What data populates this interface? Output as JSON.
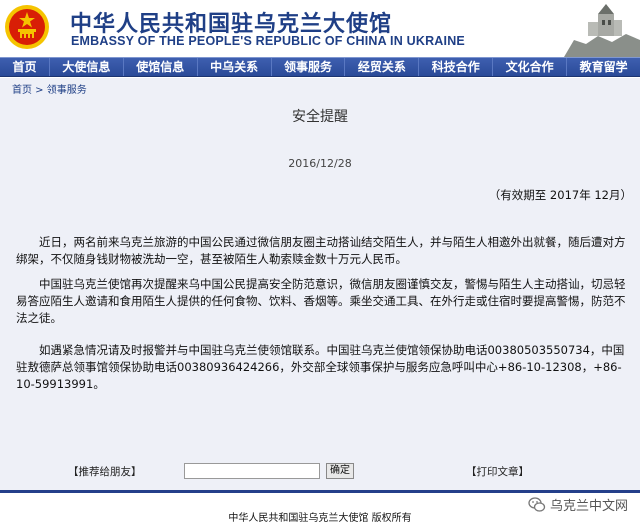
{
  "header": {
    "title_cn": "中华人民共和国驻乌克兰大使馆",
    "title_en": "EMBASSY OF THE PEOPLE'S REPUBLIC OF CHINA IN UKRAINE"
  },
  "nav": {
    "items": [
      "首页",
      "大使信息",
      "使馆信息",
      "中乌关系",
      "领事服务",
      "经贸关系",
      "科技合作",
      "文化合作",
      "教育留学"
    ]
  },
  "breadcrumb": {
    "home": "首页",
    "separator": " > ",
    "current": "领事服务"
  },
  "article": {
    "title": "安全提醒",
    "date": "2016/12/28",
    "validity": "（有效期至 2017年 12月）",
    "paragraphs": [
      "近日，两名前来乌克兰旅游的中国公民通过微信朋友圈主动搭讪结交陌生人，并与陌生人相邀外出就餐，随后遭对方绑架，不仅随身钱财物被洗劫一空，甚至被陌生人勒索赎金数十万元人民币。",
      "中国驻乌克兰使馆再次提醒来乌中国公民提高安全防范意识，微信朋友圈谨慎交友，警惕与陌生人主动搭讪，切忌轻易答应陌生人邀请和食用陌生人提供的任何食物、饮料、香烟等。乘坐交通工具、在外行走或住宿时要提高警惕，防范不法之徒。",
      "如遇紧急情况请及时报警并与中国驻乌克兰使领馆联系。中国驻乌克兰使馆领保协助电话00380503550734，中国驻敖德萨总领事馆领保协助电话00380936424266，外交部全球领事保护与服务应急呼叫中心+86-10-12308，+86-10-59913991。"
    ]
  },
  "actions": {
    "share_label": "【推荐给朋友】",
    "share_input_value": "",
    "confirm_label": "确定",
    "print_label": "【打印文章】"
  },
  "footer": {
    "copyright": "中华人民共和国驻乌克兰大使馆  版权所有",
    "watermark": "乌克兰中文网"
  },
  "colors": {
    "brand_blue": "#1f3f86",
    "nav_bg": "#2a4a98",
    "content_bg": "#eef0f7",
    "emblem_red": "#d81e06",
    "emblem_gold": "#f5c400"
  }
}
